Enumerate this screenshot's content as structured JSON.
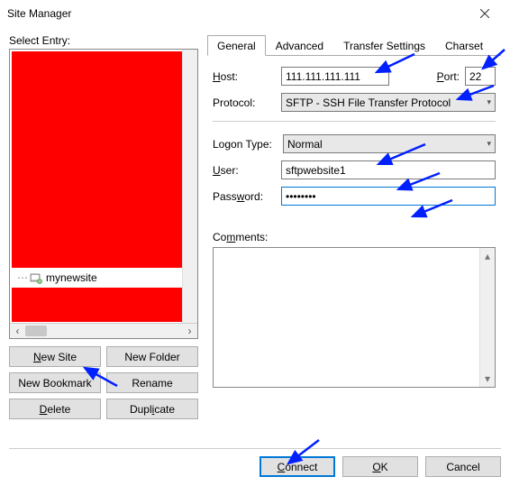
{
  "window": {
    "title": "Site Manager"
  },
  "left": {
    "label": "Select Entry:",
    "site_name": "mynewsite",
    "buttons": {
      "new_site": "New Site",
      "new_folder": "New Folder",
      "new_bookmark": "New Bookmark",
      "rename": "Rename",
      "delete": "Delete",
      "duplicate": "Duplicate"
    }
  },
  "tabs": {
    "general": "General",
    "advanced": "Advanced",
    "transfer": "Transfer Settings",
    "charset": "Charset"
  },
  "form": {
    "host_label": "Host:",
    "host_value": "111.111.111.111",
    "port_label": "Port:",
    "port_value": "22",
    "protocol_label": "Protocol:",
    "protocol_value": "SFTP - SSH File Transfer Protocol",
    "logon_label": "Logon Type:",
    "logon_value": "Normal",
    "user_label": "User:",
    "user_value": "sftpwebsite1",
    "password_label": "Password:",
    "password_value": "••••••••",
    "comments_label": "Comments:"
  },
  "footer": {
    "connect": "Connect",
    "ok": "OK",
    "cancel": "Cancel"
  }
}
